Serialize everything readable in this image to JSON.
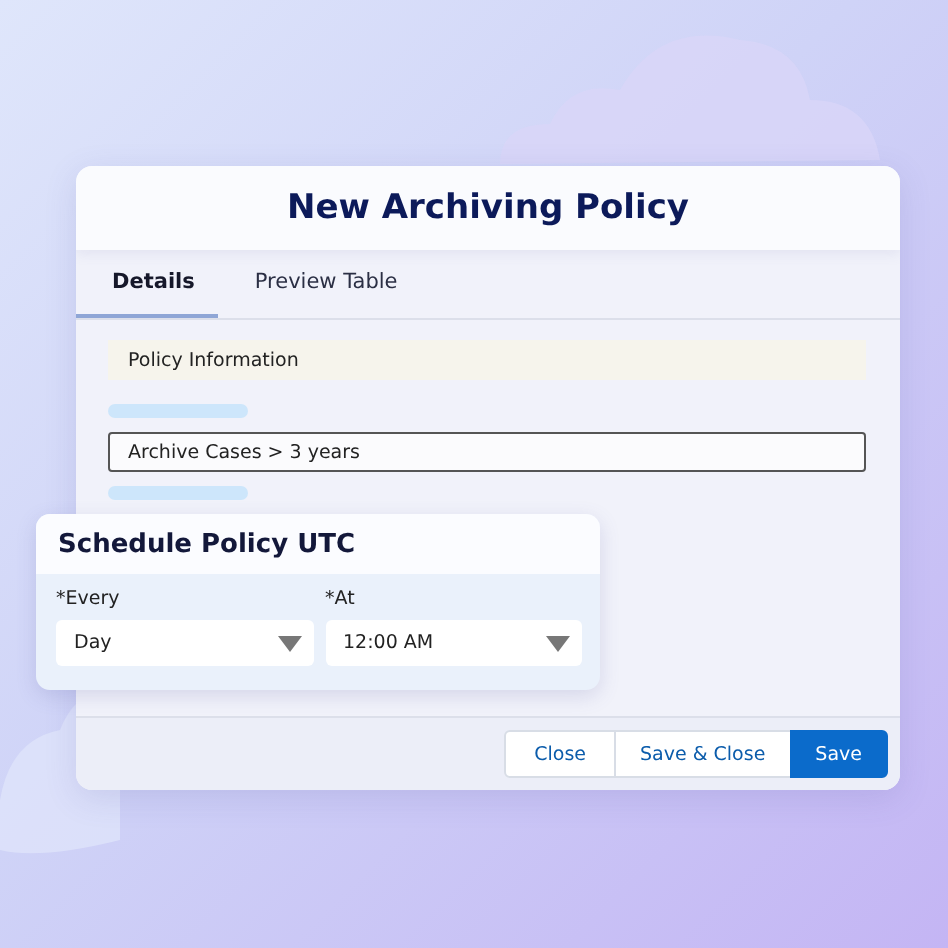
{
  "dialog": {
    "title": "New Archiving Policy",
    "tabs": [
      {
        "label": "Details",
        "selected": true
      },
      {
        "label": "Preview Table",
        "selected": false
      }
    ],
    "section_header": "Policy Information",
    "name_field": {
      "value": "Archive Cases > 3 years"
    },
    "buttons": [
      {
        "label": "Close",
        "kind": "neutral"
      },
      {
        "label": "Save & Close",
        "kind": "neutral"
      },
      {
        "label": "Save",
        "kind": "brand"
      }
    ]
  },
  "schedule_panel": {
    "title": "Schedule Policy UTC",
    "fields": [
      {
        "label": "*Every",
        "value": "Day"
      },
      {
        "label": "*At",
        "value": "12:00 AM"
      }
    ]
  }
}
